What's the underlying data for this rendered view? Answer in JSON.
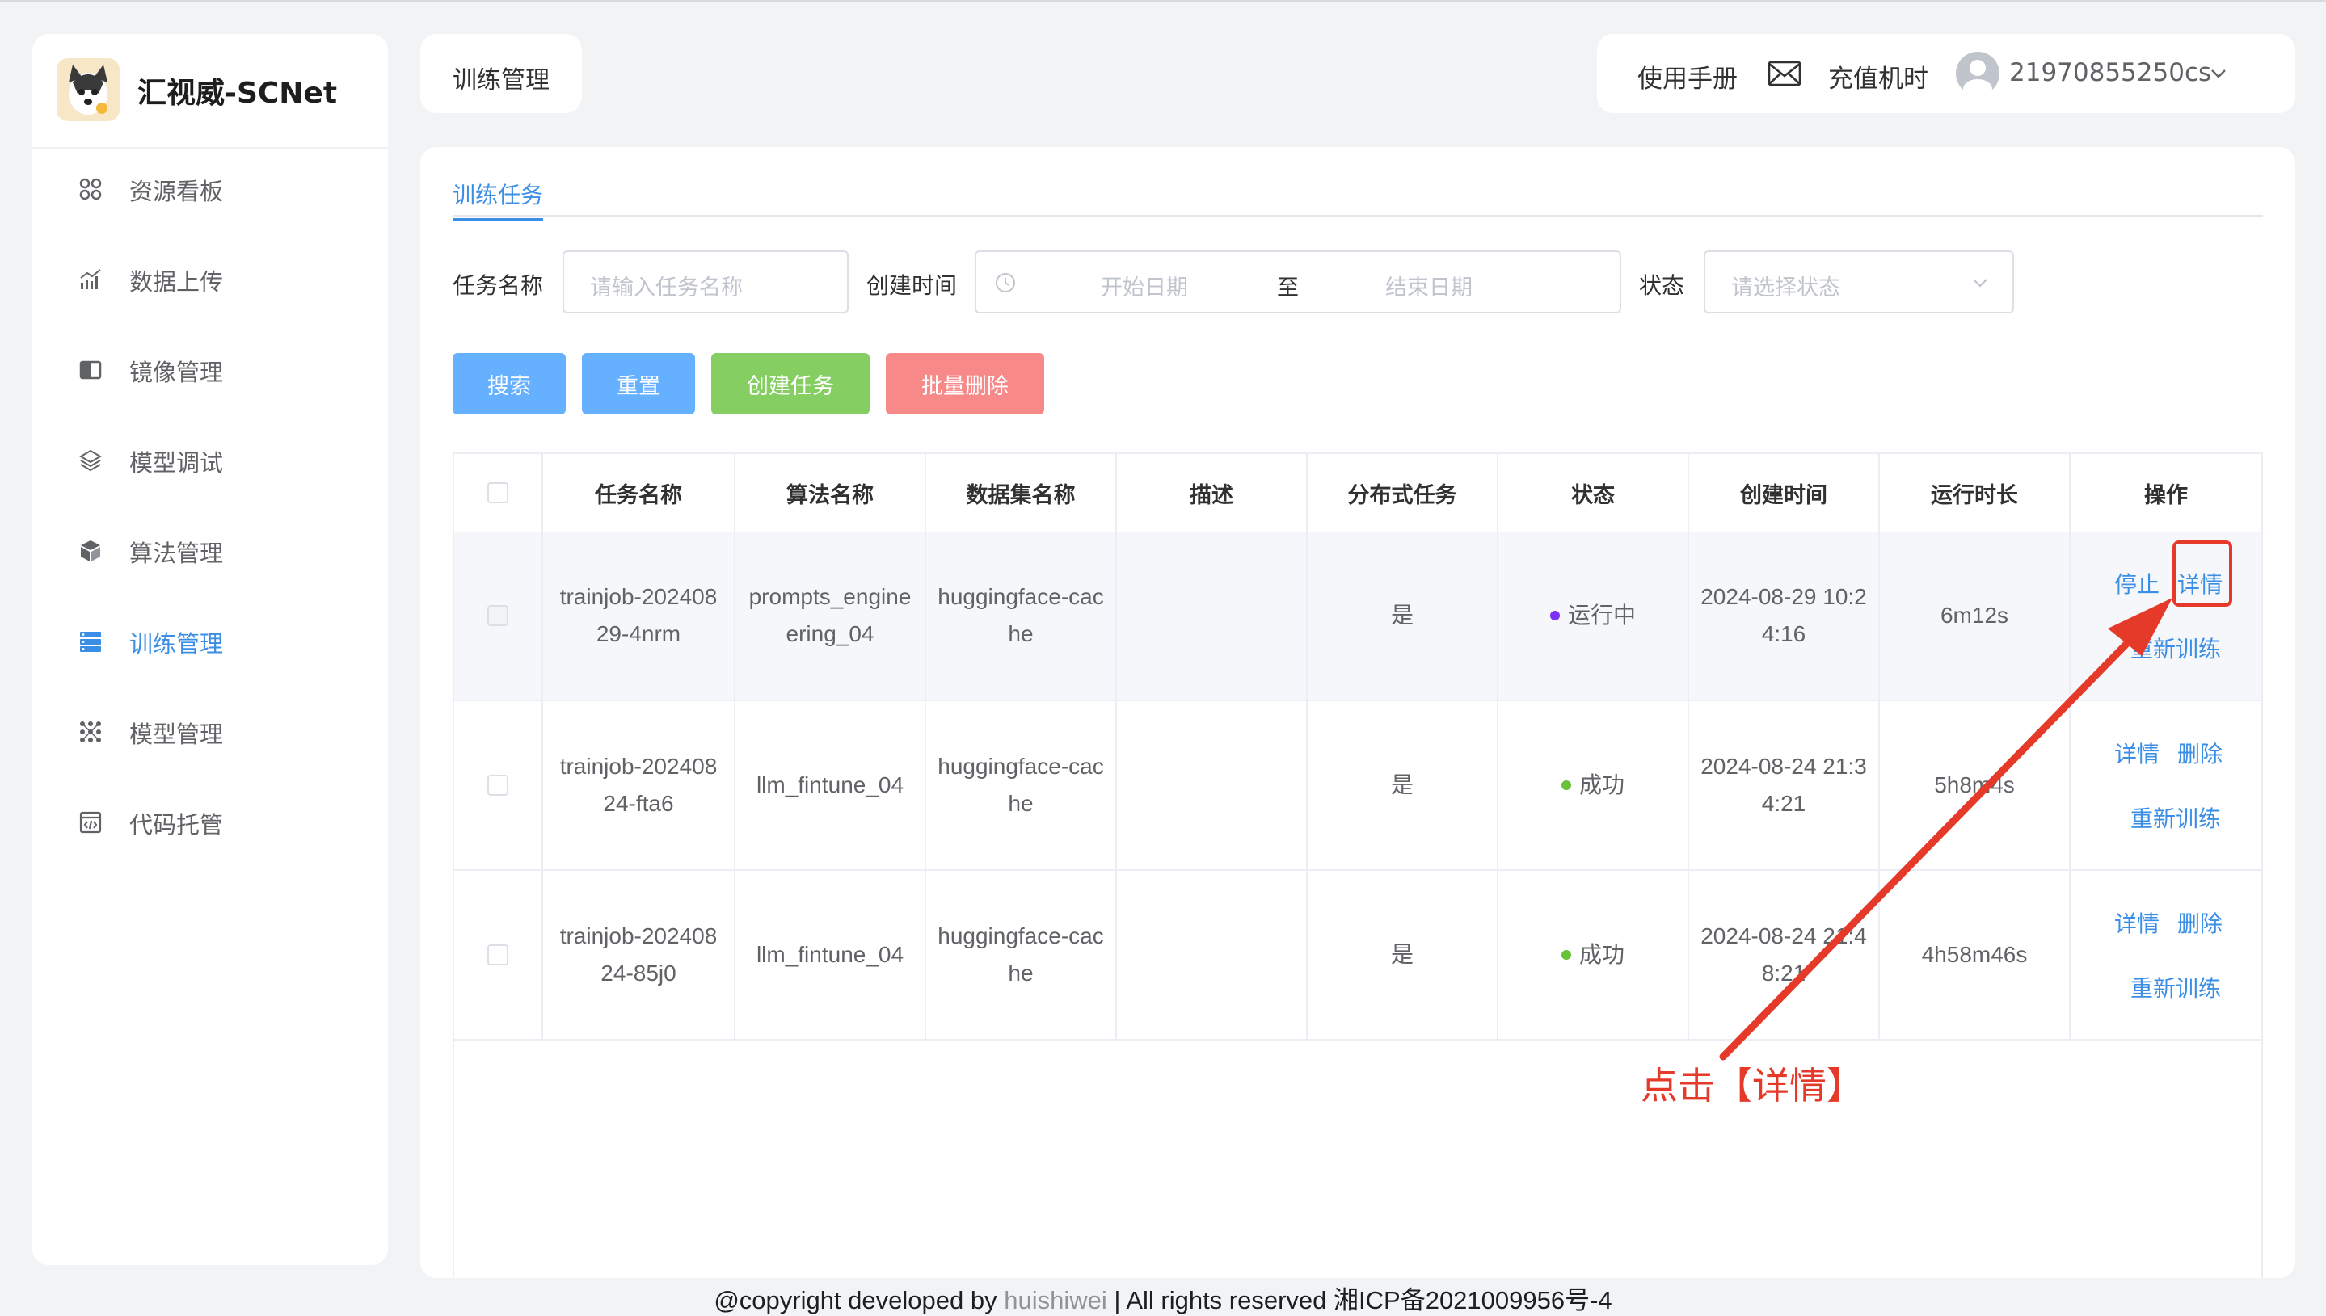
{
  "app": {
    "title": "汇视威-SCNet"
  },
  "sidebar": {
    "items": [
      {
        "label": "资源看板",
        "icon": "dashboard-icon"
      },
      {
        "label": "数据上传",
        "icon": "upload-chart-icon"
      },
      {
        "label": "镜像管理",
        "icon": "image-icon"
      },
      {
        "label": "模型调试",
        "icon": "debug-icon"
      },
      {
        "label": "算法管理",
        "icon": "algorithm-icon"
      },
      {
        "label": "训练管理",
        "icon": "training-icon",
        "active": true
      },
      {
        "label": "模型管理",
        "icon": "model-icon"
      },
      {
        "label": "代码托管",
        "icon": "code-icon"
      }
    ]
  },
  "header": {
    "breadcrumb": "训练管理",
    "manual": "使用手册",
    "recharge": "充值机时",
    "username": "21970855250cs"
  },
  "tabs": {
    "active": "训练任务"
  },
  "filters": {
    "task_name_label": "任务名称",
    "task_name_placeholder": "请输入任务名称",
    "created_label": "创建时间",
    "start_placeholder": "开始日期",
    "date_separator": "至",
    "end_placeholder": "结束日期",
    "status_label": "状态",
    "status_placeholder": "请选择状态"
  },
  "buttons": {
    "search": "搜索",
    "reset": "重置",
    "create": "创建任务",
    "batch_delete": "批量删除"
  },
  "table": {
    "columns": [
      "任务名称",
      "算法名称",
      "数据集名称",
      "描述",
      "分布式任务",
      "状态",
      "创建时间",
      "运行时长",
      "操作"
    ],
    "rows": [
      {
        "task": "trainjob-20240829-4nrm",
        "algorithm": "prompts_engineering_04",
        "dataset": "huggingface-cache",
        "description": "",
        "distributed": "是",
        "status": "运行中",
        "status_color": "#7b2ff7",
        "created": "2024-08-29 10:24:16",
        "duration": "6m12s",
        "ops": [
          "停止",
          "详情",
          "重新训练"
        ]
      },
      {
        "task": "trainjob-20240824-fta6",
        "algorithm": "llm_fintune_04",
        "dataset": "huggingface-cache",
        "description": "",
        "distributed": "是",
        "status": "成功",
        "status_color": "#67c23a",
        "created": "2024-08-24 21:34:21",
        "duration": "5h8m4s",
        "ops": [
          "详情",
          "删除",
          "重新训练"
        ]
      },
      {
        "task": "trainjob-20240824-85j0",
        "algorithm": "llm_fintune_04",
        "dataset": "huggingface-cache",
        "description": "",
        "distributed": "是",
        "status": "成功",
        "status_color": "#67c23a",
        "created": "2024-08-24 21:48:21",
        "duration": "4h58m46s",
        "ops": [
          "详情",
          "删除",
          "重新训练"
        ]
      }
    ]
  },
  "annotation": {
    "text": "点击【详情】",
    "color": "#e53a29"
  },
  "footer": {
    "prefix": "@copyright developed by ",
    "link": "huishiwei",
    "suffix": " | All rights reserved 湘ICP备2021009956号-4"
  },
  "colors": {
    "primary": "#409eff",
    "success": "#67c23a",
    "danger": "#f56c6c",
    "annotation": "#e53a29"
  }
}
